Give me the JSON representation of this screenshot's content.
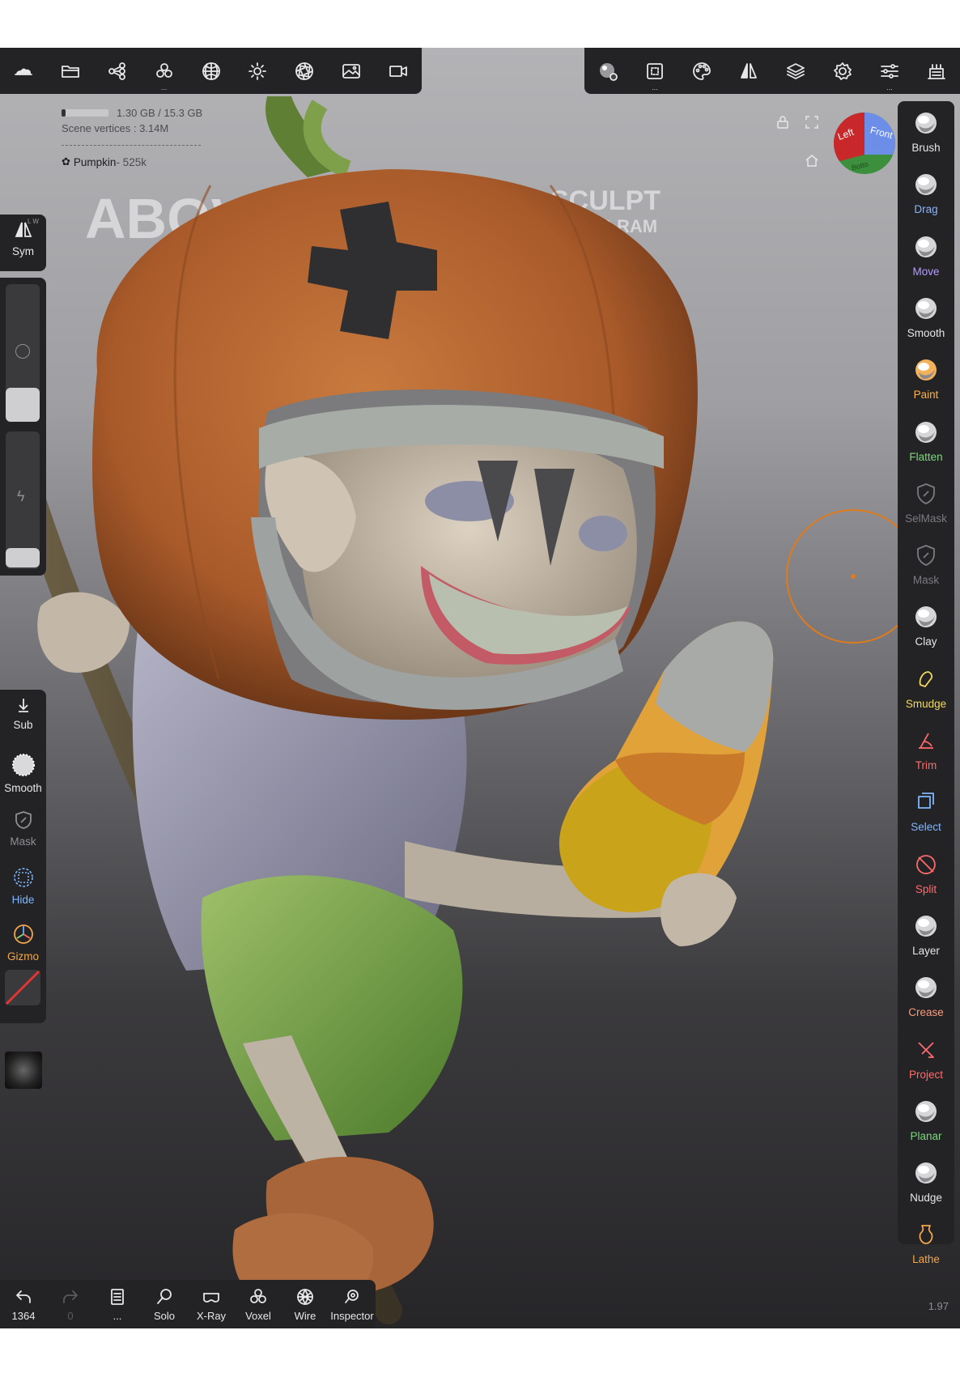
{
  "top_toolbar_left": [
    {
      "name": "cloud-icon"
    },
    {
      "name": "folder-icon"
    },
    {
      "name": "share-nodes-icon"
    },
    {
      "name": "scene-tree-icon"
    },
    {
      "name": "sphere-grid-icon"
    },
    {
      "name": "sun-icon"
    },
    {
      "name": "aperture-icon"
    },
    {
      "name": "image-icon"
    },
    {
      "name": "camera-icon"
    }
  ],
  "top_toolbar_right": [
    {
      "name": "material-ball-icon"
    },
    {
      "name": "topology-icon"
    },
    {
      "name": "palette-icon"
    },
    {
      "name": "symmetry-icon"
    },
    {
      "name": "layers-icon"
    },
    {
      "name": "gear-icon"
    },
    {
      "name": "sliders-icon"
    },
    {
      "name": "interface-icon"
    }
  ],
  "info": {
    "memory": "1.30 GB / 15.3 GB",
    "memory_fraction": 0.085,
    "vertices": "Scene vertices : 3.14M",
    "object": "Pumpkin",
    "object_count": " - 525k"
  },
  "watermark": {
    "left": "ABOVE",
    "right": "SCULPT",
    "right_sub": "B RAM"
  },
  "gizmo": {
    "left": "Left",
    "front": "Front",
    "bottom": "Botto"
  },
  "left_panel_top": {
    "sym_label": "Sym",
    "sym_tag": "L W"
  },
  "left_panel_bottom": [
    {
      "label": "Sub",
      "color": "#e7e7e9",
      "icon": "arrow-down-icon"
    },
    {
      "label": "Smooth",
      "color": "#e7e7e9",
      "icon": "smooth-ball-icon"
    },
    {
      "label": "Mask",
      "color": "#8e8e93",
      "icon": "mask-shield-icon"
    },
    {
      "label": "Hide",
      "color": "#7fb6ff",
      "icon": "hide-grid-icon"
    },
    {
      "label": "Gizmo",
      "color": "#f4a64a",
      "icon": "gizmo-icon"
    }
  ],
  "tools": [
    {
      "label": "Brush",
      "color": "#e7e7e9"
    },
    {
      "label": "Drag",
      "color": "#8ab4f8"
    },
    {
      "label": "Move",
      "color": "#b49cff"
    },
    {
      "label": "Smooth",
      "color": "#e7e7e9"
    },
    {
      "label": "Paint",
      "color": "#ffb347"
    },
    {
      "label": "Flatten",
      "color": "#7ed67e"
    },
    {
      "label": "SelMask",
      "color": "#7a7a80"
    },
    {
      "label": "Mask",
      "color": "#7a7a80"
    },
    {
      "label": "Clay",
      "color": "#e7e7e9"
    },
    {
      "label": "Smudge",
      "color": "#f3d95b"
    },
    {
      "label": "Trim",
      "color": "#ff6b6b"
    },
    {
      "label": "Select",
      "color": "#7fb6ff"
    },
    {
      "label": "Split",
      "color": "#ff6b6b"
    },
    {
      "label": "Layer",
      "color": "#e7e7e9"
    },
    {
      "label": "Crease",
      "color": "#ff9b7a"
    },
    {
      "label": "Project",
      "color": "#ff6b6b"
    },
    {
      "label": "Planar",
      "color": "#7ed67e"
    },
    {
      "label": "Nudge",
      "color": "#e7e7e9"
    },
    {
      "label": "Lathe",
      "color": "#f4a64a"
    }
  ],
  "bottom_bar": {
    "undo_count": "1364",
    "redo_count": "0",
    "menu_label": "...",
    "solo": "Solo",
    "xray": "X-Ray",
    "voxel": "Voxel",
    "wire": "Wire",
    "inspector": "Inspector"
  },
  "version": "1.97"
}
